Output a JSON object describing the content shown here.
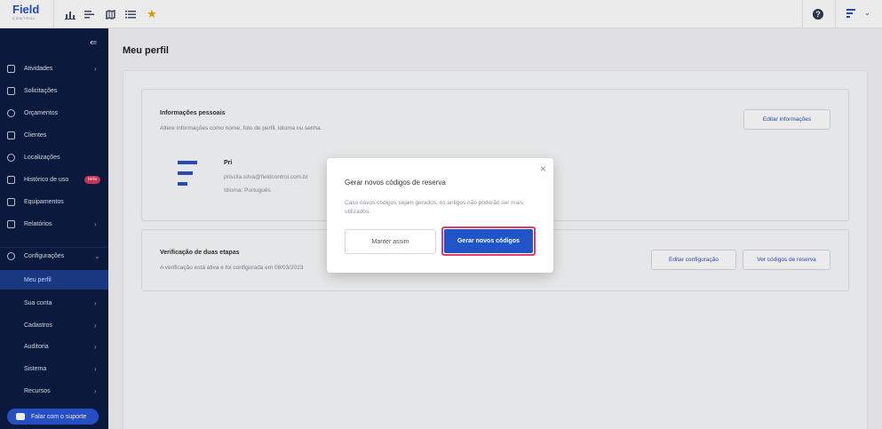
{
  "topbar": {
    "logo_text": "Field",
    "logo_sub": "CONTROL",
    "icons": [
      "bar-chart-icon",
      "list-filter-icon",
      "map-icon",
      "list-icon",
      "star-icon"
    ],
    "star_color": "#f0a500"
  },
  "sidebar": {
    "items": [
      {
        "label": "Atividades",
        "icon": "clipboard-icon",
        "arrow": "›"
      },
      {
        "label": "Solicitações",
        "icon": "inbox-icon",
        "arrow": ""
      },
      {
        "label": "Orçamentos",
        "icon": "dollar-icon",
        "arrow": ""
      },
      {
        "label": "Clientes",
        "icon": "contacts-icon",
        "arrow": ""
      },
      {
        "label": "Localizações",
        "icon": "location-pin-icon",
        "arrow": ""
      },
      {
        "label": "Histórico de uso",
        "icon": "car-icon",
        "arrow": "",
        "badge": "beta"
      },
      {
        "label": "Equipamentos",
        "icon": "server-icon",
        "arrow": ""
      },
      {
        "label": "Relatórios",
        "icon": "report-icon",
        "arrow": "›"
      }
    ],
    "settings": {
      "label": "Configurações",
      "icon": "gear-icon",
      "arrow": "⌄"
    },
    "sub_items": [
      {
        "label": "Meu perfil",
        "arrow": "",
        "active": true
      },
      {
        "label": "Sua conta",
        "arrow": "›"
      },
      {
        "label": "Cadastros",
        "arrow": "›"
      },
      {
        "label": "Auditoria",
        "arrow": "›"
      },
      {
        "label": "Sistema",
        "arrow": "›"
      },
      {
        "label": "Recursos",
        "arrow": "›"
      }
    ],
    "support_label": "Falar com o suporte",
    "accent": "#1d3c8c",
    "badge_color": "#d43a5b"
  },
  "main": {
    "title": "Meu perfil",
    "personal": {
      "title": "Informações pessoais",
      "desc": "Altere informações como nome, foto de perfil, idioma ou senha.",
      "edit_label": "Editar informações",
      "name": "Pri",
      "email": "priscila.silva@fieldcontrol.com.br",
      "language": "Idioma: Português"
    },
    "twofa": {
      "title": "Verificação de duas etapas",
      "desc": "A verificação está ativa e foi configurada em 08/03/2023",
      "edit_label": "Editar configuração",
      "codes_label": "Ver códigos de reserva"
    }
  },
  "modal": {
    "close": "×",
    "title": "Gerar novos códigos de reserva",
    "body": "Caso novos códigos sejam gerados, os antigos não poderão ser mais utilizados.",
    "cancel_label": "Manter assim",
    "confirm_label": "Gerar novos códigos",
    "confirm_color": "#1f55c9",
    "highlight_color": "#e03a6a"
  }
}
